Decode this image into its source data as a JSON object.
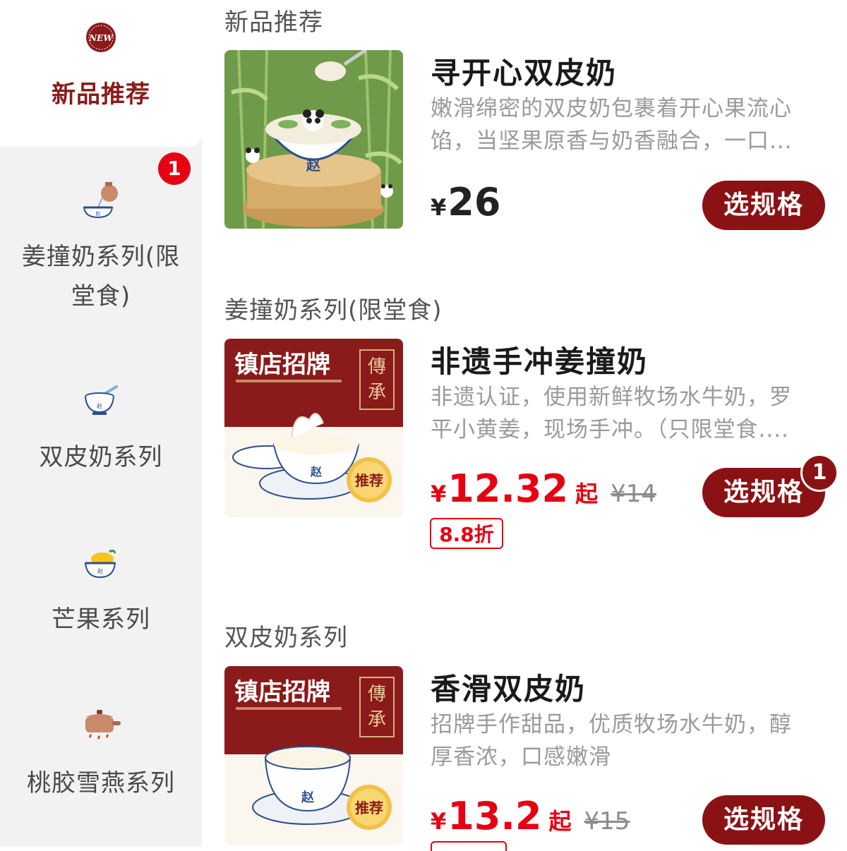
{
  "sidebar": {
    "items": [
      {
        "label": "新品推荐",
        "icon": "new-badge-icon",
        "active": true
      },
      {
        "label_line1": "姜撞奶系列(限",
        "label_line2": "堂食)",
        "icon": "pouring-milk-bowl-icon",
        "badge": "1"
      },
      {
        "label": "双皮奶系列",
        "icon": "bowl-spoon-icon"
      },
      {
        "label": "芒果系列",
        "icon": "mango-bowl-icon"
      },
      {
        "label": "桃胶雪燕系列",
        "icon": "stew-pot-icon"
      }
    ]
  },
  "sections": [
    {
      "title": "新品推荐",
      "product": {
        "name": "寻开心双皮奶",
        "desc_line1": "嫩滑绵密的双皮奶包裹着开心果流心",
        "desc_line2": "馅，当坚果原香与奶香融合，一口...",
        "currency": "¥",
        "price": "26",
        "button": "选规格",
        "image": "panda-double-skin-milk-photo"
      }
    },
    {
      "title": "姜撞奶系列(限堂食)",
      "product": {
        "name": "非遗手冲姜撞奶",
        "desc_line1": "非遗认证，使用新鲜牧场水牛奶，罗",
        "desc_line2": "平小黄姜，现场手冲。（只限堂食....",
        "currency": "¥",
        "price": "12.32",
        "price_suffix": "起",
        "original_price": "¥14",
        "discount": "8.8折",
        "button": "选规格",
        "cart_count": "1",
        "image": {
          "headline": "镇店招牌",
          "seal": "傳承",
          "tag": "推荐"
        }
      }
    },
    {
      "title": "双皮奶系列",
      "product": {
        "name": "香滑双皮奶",
        "desc_line1": "招牌手作甜品，优质牧场水牛奶，醇",
        "desc_line2": "厚香浓，口感嫩滑",
        "currency": "¥",
        "price": "13.2",
        "price_suffix": "起",
        "original_price": "¥15",
        "button": "选规格",
        "image": {
          "headline": "镇店招牌",
          "seal": "傳承",
          "tag": "推荐"
        }
      }
    }
  ],
  "colors": {
    "brand": "#8b1214",
    "price_red": "#e60012",
    "sidebar_bg": "#f2f2f2"
  }
}
